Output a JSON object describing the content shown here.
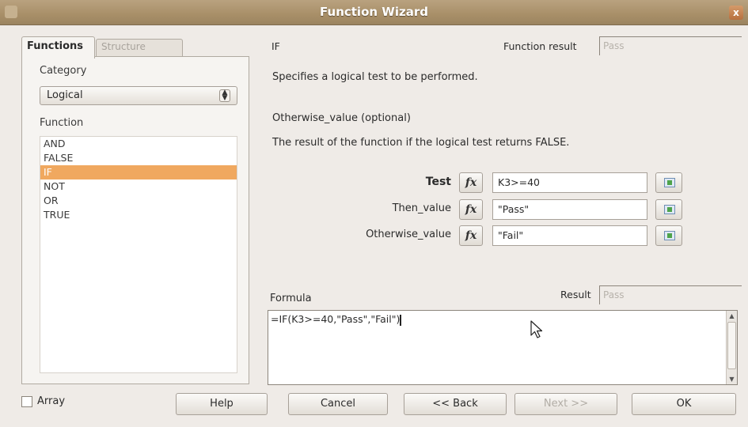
{
  "window": {
    "title": "Function Wizard",
    "close_glyph": "x"
  },
  "tabs": [
    {
      "label": "Functions"
    },
    {
      "label": "Structure"
    }
  ],
  "left": {
    "category_label": "Category",
    "category_value": "Logical",
    "function_label": "Function",
    "functions": [
      "AND",
      "FALSE",
      "IF",
      "NOT",
      "OR",
      "TRUE"
    ],
    "selected_index": 2
  },
  "right": {
    "function_name": "IF",
    "function_result_label": "Function result",
    "function_result_value": "Pass",
    "description": "Specifies a logical test to be performed.",
    "argument_title": "Otherwise_value (optional)",
    "argument_description": "The result of the function if the logical test returns FALSE.",
    "fx_glyph": "fx",
    "args": [
      {
        "label": "Test",
        "value": "K3>=40"
      },
      {
        "label": "Then_value",
        "value": "\"Pass\""
      },
      {
        "label": "Otherwise_value",
        "value": "\"Fail\""
      }
    ],
    "formula_label": "Formula",
    "result_label": "Result",
    "result_value": "Pass",
    "formula": "=IF(K3>=40,\"Pass\",\"Fail\")"
  },
  "buttons": {
    "array": "Array",
    "help": "Help",
    "cancel": "Cancel",
    "back": "<< Back",
    "next": "Next >>",
    "ok": "OK"
  },
  "colors": {
    "selection": "#f0a85f",
    "titlebar": "#a88f68"
  }
}
